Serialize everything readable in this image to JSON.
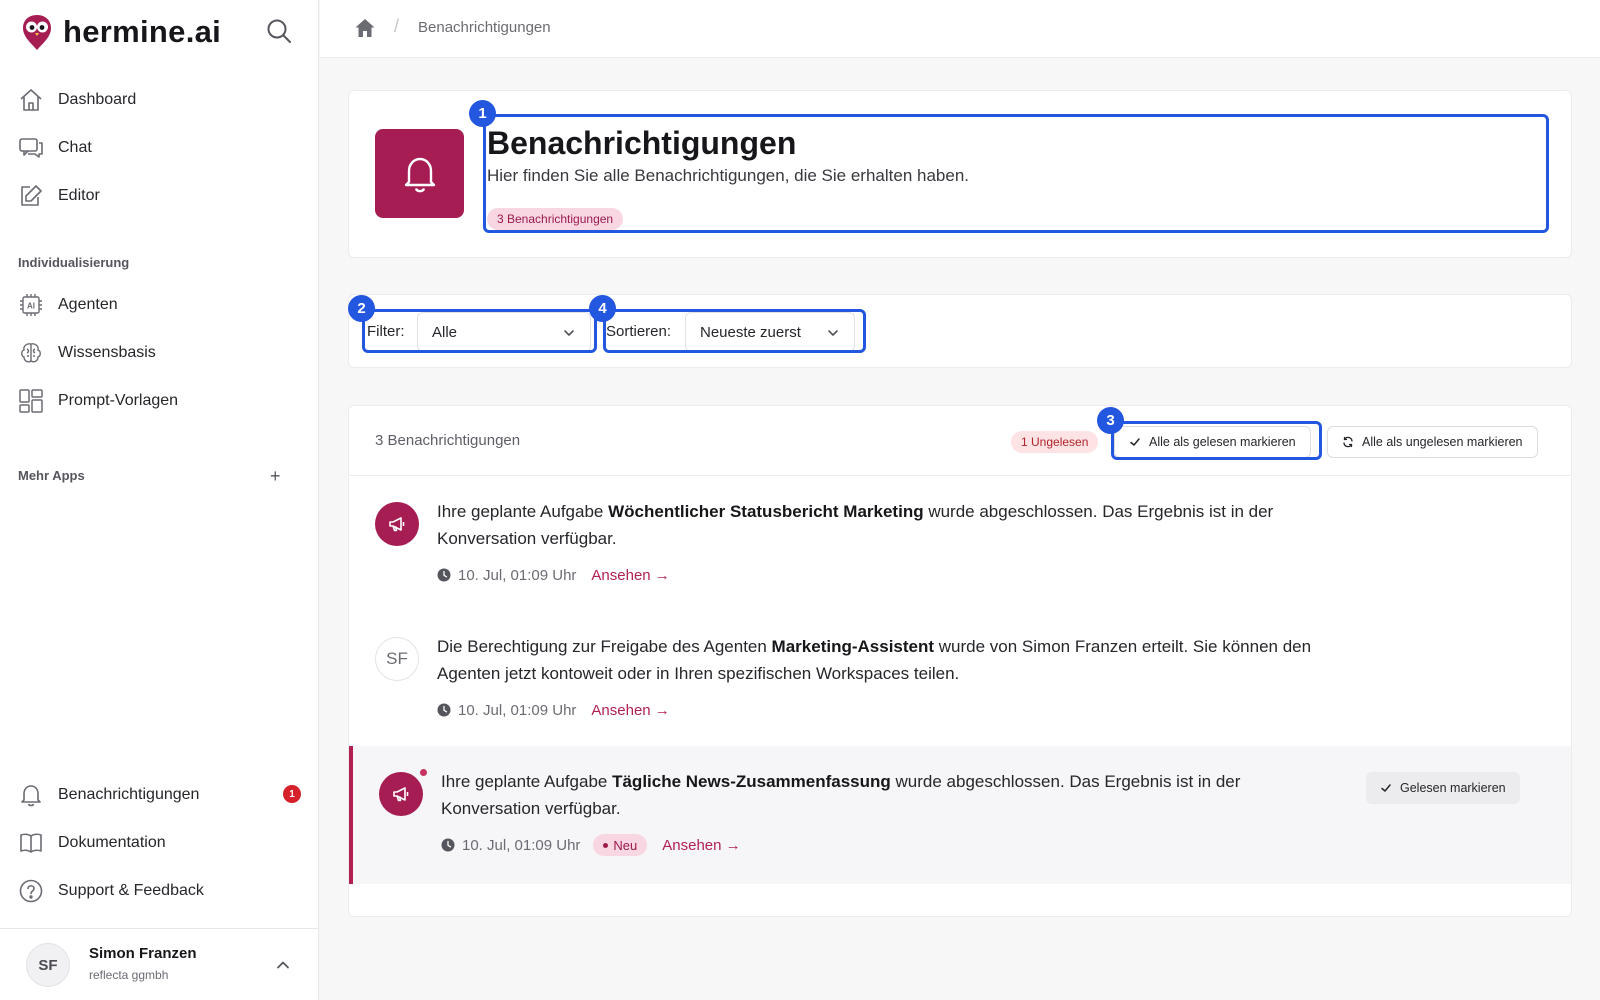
{
  "brand": {
    "name": "hermine.ai",
    "accent": "#a51d53"
  },
  "sidebar": {
    "main_items": [
      {
        "label": "Dashboard",
        "icon": "home-icon"
      },
      {
        "label": "Chat",
        "icon": "chat-icon"
      },
      {
        "label": "Editor",
        "icon": "edit-icon"
      }
    ],
    "section_custom": "Individualisierung",
    "custom_items": [
      {
        "label": "Agenten",
        "icon": "ai-chip-icon"
      },
      {
        "label": "Wissensbasis",
        "icon": "brain-icon"
      },
      {
        "label": "Prompt-Vorlagen",
        "icon": "template-icon"
      }
    ],
    "section_more": "Mehr Apps",
    "more_add": "+",
    "bottom_items": [
      {
        "label": "Benachrichtigungen",
        "icon": "bell-icon",
        "badge": "1"
      },
      {
        "label": "Dokumentation",
        "icon": "book-icon"
      },
      {
        "label": "Support & Feedback",
        "icon": "help-icon"
      }
    ],
    "user": {
      "initials": "SF",
      "name": "Simon Franzen",
      "org": "reflecta ggmbh"
    }
  },
  "breadcrumb": {
    "separator": "/",
    "current": "Benachrichtigungen"
  },
  "header": {
    "title": "Benachrichtigungen",
    "subtitle": "Hier finden Sie alle Benachrichtigungen, die Sie erhalten haben.",
    "count_badge": "3 Benachrichtigungen"
  },
  "controls": {
    "filter_label": "Filter:",
    "filter_value": "Alle",
    "sort_label": "Sortieren:",
    "sort_value": "Neueste zuerst"
  },
  "list": {
    "count": "3 Benachrichtigungen",
    "unread_badge": "1 Ungelesen",
    "mark_all_read": "Alle als gelesen markieren",
    "mark_all_unread": "Alle als ungelesen markieren",
    "items": [
      {
        "pre": "Ihre geplante Aufgabe ",
        "bold": "Wöchentlicher Statusbericht Marketing",
        "post": " wurde abgeschlossen. Das Ergebnis ist in der Konversation verfügbar.",
        "time": "10. Jul, 01:09 Uhr",
        "link": "Ansehen →"
      },
      {
        "avatar": "SF",
        "pre": "Die Berechtigung zur Freigabe des Agenten ",
        "bold": "Marketing-Assistent",
        "post": " wurde von Simon Franzen erteilt. Sie können den Agenten jetzt kontoweit oder in Ihren spezifischen Workspaces teilen.",
        "time": "10. Jul, 01:09 Uhr",
        "link": "Ansehen →"
      },
      {
        "pre": "Ihre geplante Aufgabe ",
        "bold": "Tägliche News-Zusammenfassung",
        "post": " wurde abgeschlossen. Das Ergebnis ist in der Konversation verfügbar.",
        "time": "10. Jul, 01:09 Uhr",
        "new_badge": "Neu",
        "link": "Ansehen →",
        "mark_read": "Gelesen markieren"
      }
    ]
  },
  "callouts": [
    "1",
    "2",
    "3",
    "4"
  ]
}
